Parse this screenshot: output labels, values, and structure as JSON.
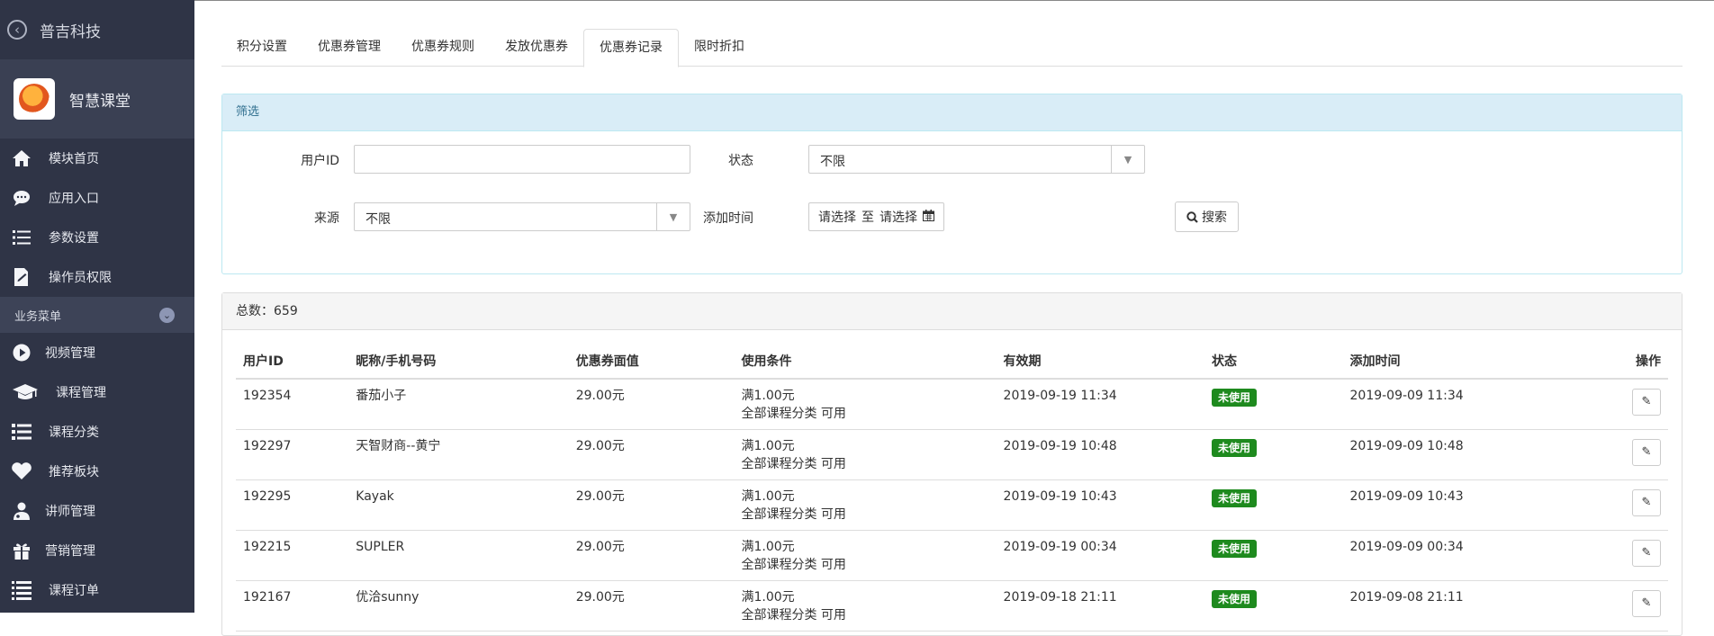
{
  "sidebar": {
    "company": "普吉科技",
    "brand_name": "智慧课堂",
    "items_top": [
      {
        "label": "模块首页",
        "icon": "home-icon"
      },
      {
        "label": "应用入口",
        "icon": "chat-bubble-icon"
      },
      {
        "label": "参数设置",
        "icon": "settings-list-icon"
      },
      {
        "label": "操作员权限",
        "icon": "permission-doc-icon"
      }
    ],
    "section_label": "业务菜单",
    "items_business": [
      {
        "label": "视频管理",
        "icon": "play-icon"
      },
      {
        "label": "课程管理",
        "icon": "graduation-cap-icon"
      },
      {
        "label": "课程分类",
        "icon": "list-icon"
      },
      {
        "label": "推荐板块",
        "icon": "heart-icon"
      },
      {
        "label": "讲师管理",
        "icon": "teacher-icon"
      },
      {
        "label": "营销管理",
        "icon": "gift-icon"
      },
      {
        "label": "课程订单",
        "icon": "order-list-icon"
      }
    ]
  },
  "tabs": [
    "积分设置",
    "优惠券管理",
    "优惠券规则",
    "发放优惠券",
    "优惠券记录",
    "限时折扣"
  ],
  "active_tab": "优惠券记录",
  "filter": {
    "heading": "筛选",
    "user_id_label": "用户ID",
    "user_id_value": "",
    "status_label": "状态",
    "status_value": "不限",
    "source_label": "来源",
    "source_value": "不限",
    "add_time_label": "添加时间",
    "date_start": "请选择",
    "date_sep": "至",
    "date_end": "请选择",
    "search_label": "搜索"
  },
  "list": {
    "total_text": "总数：659",
    "columns": [
      "用户ID",
      "昵称/手机号码",
      "优惠券面值",
      "使用条件",
      "有效期",
      "状态",
      "添加时间",
      "操作"
    ],
    "rows": [
      {
        "uid": "192354",
        "name": "番茄小子",
        "value": "29.00元",
        "cond1": "满1.00元",
        "cond2": "全部课程分类 可用",
        "expire": "2019-09-19 11:34",
        "status": "未使用",
        "added": "2019-09-09 11:34"
      },
      {
        "uid": "192297",
        "name": "天智财商--黄宁",
        "value": "29.00元",
        "cond1": "满1.00元",
        "cond2": "全部课程分类 可用",
        "expire": "2019-09-19 10:48",
        "status": "未使用",
        "added": "2019-09-09 10:48"
      },
      {
        "uid": "192295",
        "name": "Kayak",
        "value": "29.00元",
        "cond1": "满1.00元",
        "cond2": "全部课程分类 可用",
        "expire": "2019-09-19 10:43",
        "status": "未使用",
        "added": "2019-09-09 10:43"
      },
      {
        "uid": "192215",
        "name": "SUPLER",
        "value": "29.00元",
        "cond1": "满1.00元",
        "cond2": "全部课程分类 可用",
        "expire": "2019-09-19 00:34",
        "status": "未使用",
        "added": "2019-09-09 00:34"
      },
      {
        "uid": "192167",
        "name": "优洽sunny",
        "value": "29.00元",
        "cond1": "满1.00元",
        "cond2": "全部课程分类 可用",
        "expire": "2019-09-18 21:11",
        "status": "未使用",
        "added": "2019-09-08 21:11"
      }
    ]
  }
}
